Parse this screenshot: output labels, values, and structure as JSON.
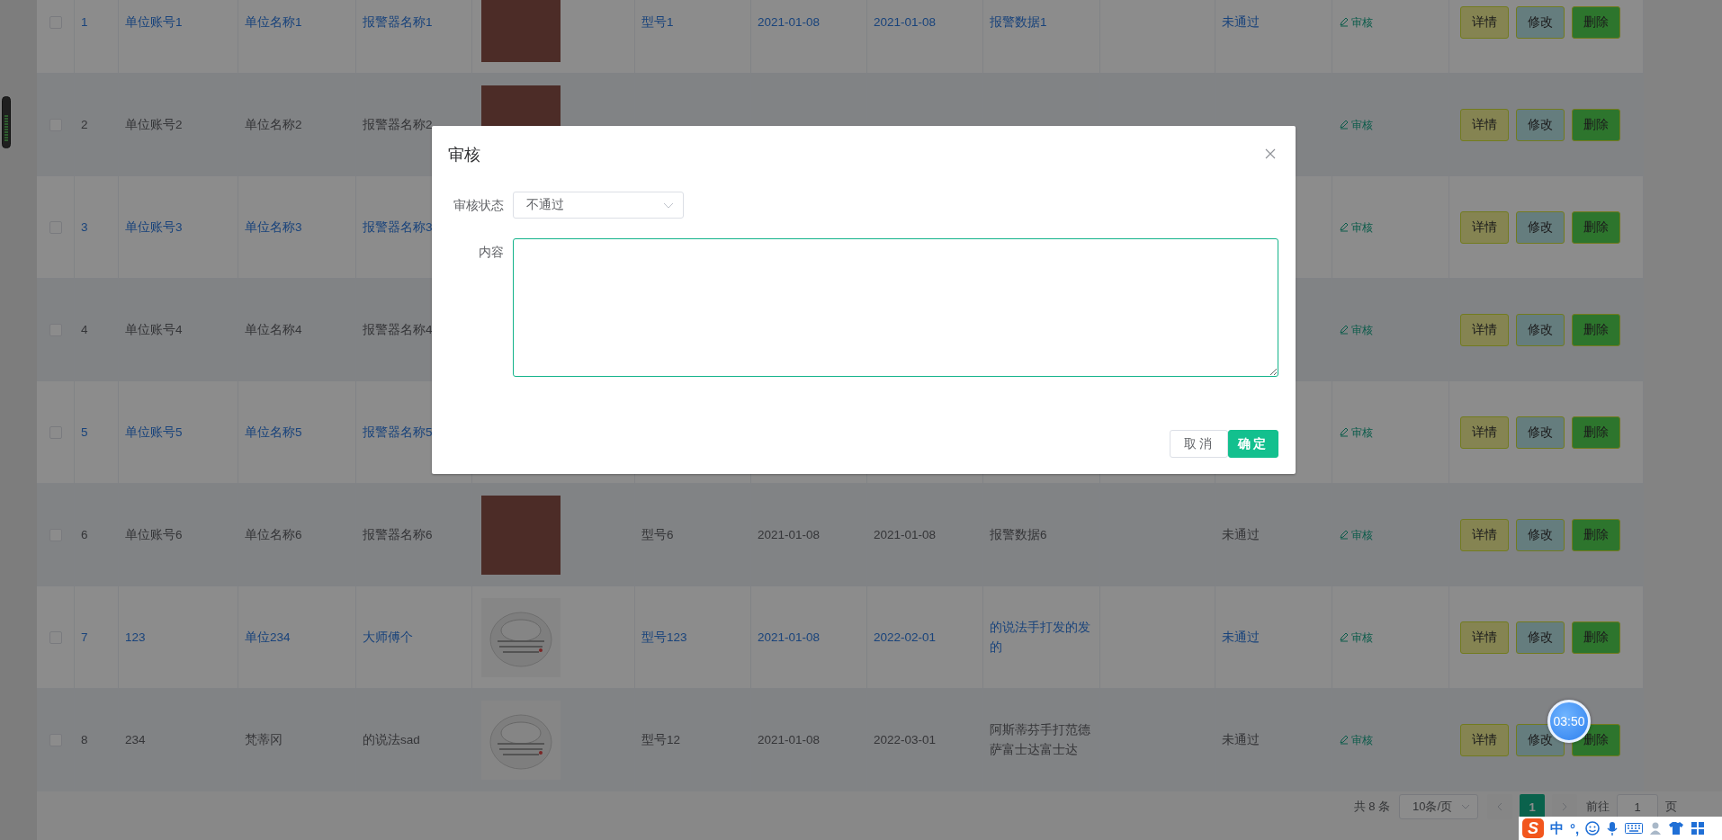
{
  "table": {
    "rows": [
      {
        "checked": false,
        "highlighted": true,
        "index": "1",
        "account": "单位账号1",
        "unit": "单位名称1",
        "alarm_name": "报警器名称1",
        "image": {
          "kind": "photo"
        },
        "model": "型号1",
        "date_1": "2021-01-08",
        "date_2": "2021-01-08",
        "alarm_data": "报警数据1",
        "status": "未通过",
        "audit": "审核",
        "actions": [
          {
            "label": "详情",
            "kind": "detail"
          },
          {
            "label": "修改",
            "kind": "edit"
          },
          {
            "label": "删除",
            "kind": "delete"
          }
        ]
      },
      {
        "checked": false,
        "highlighted": false,
        "index": "2",
        "account": "单位账号2",
        "unit": "单位名称2",
        "alarm_name": "报警器名称2",
        "image": {
          "kind": "photo"
        },
        "audit": "审核",
        "actions": [
          {
            "label": "详情",
            "kind": "detail"
          },
          {
            "label": "修改",
            "kind": "edit"
          },
          {
            "label": "删除",
            "kind": "delete"
          }
        ]
      },
      {
        "checked": false,
        "highlighted": true,
        "index": "3",
        "account": "单位账号3",
        "unit": "单位名称3",
        "alarm_name": "报警器名称3",
        "audit": "审核",
        "actions": [
          {
            "label": "详情",
            "kind": "detail"
          },
          {
            "label": "修改",
            "kind": "edit"
          },
          {
            "label": "删除",
            "kind": "delete"
          }
        ]
      },
      {
        "checked": false,
        "highlighted": false,
        "index": "4",
        "account": "单位账号4",
        "unit": "单位名称4",
        "alarm_name": "报警器名称4",
        "audit": "审核",
        "actions": [
          {
            "label": "详情",
            "kind": "detail"
          },
          {
            "label": "修改",
            "kind": "edit"
          },
          {
            "label": "删除",
            "kind": "delete"
          }
        ]
      },
      {
        "checked": false,
        "highlighted": true,
        "index": "5",
        "account": "单位账号5",
        "unit": "单位名称5",
        "alarm_name": "报警器名称5",
        "audit": "审核",
        "actions": [
          {
            "label": "详情",
            "kind": "detail"
          },
          {
            "label": "修改",
            "kind": "edit"
          },
          {
            "label": "删除",
            "kind": "delete"
          }
        ]
      },
      {
        "checked": false,
        "highlighted": false,
        "index": "6",
        "account": "单位账号6",
        "unit": "单位名称6",
        "alarm_name": "报警器名称6",
        "image": {
          "kind": "photo"
        },
        "model": "型号6",
        "date_1": "2021-01-08",
        "date_2": "2021-01-08",
        "alarm_data": "报警数据6",
        "status": "未通过",
        "audit": "审核",
        "actions": [
          {
            "label": "详情",
            "kind": "detail"
          },
          {
            "label": "修改",
            "kind": "edit"
          },
          {
            "label": "删除",
            "kind": "delete"
          }
        ]
      },
      {
        "checked": false,
        "highlighted": true,
        "index": "7",
        "account": "123",
        "unit": "单位234",
        "alarm_name": "大师傅个",
        "image": {
          "kind": "detector"
        },
        "model": "型号123",
        "date_1": "2021-01-08",
        "date_2": "2022-02-01",
        "alarm_data": "的说法手打发的发的",
        "status": "未通过",
        "audit": "审核",
        "actions": [
          {
            "label": "详情",
            "kind": "detail"
          },
          {
            "label": "修改",
            "kind": "edit"
          },
          {
            "label": "删除",
            "kind": "delete"
          }
        ]
      },
      {
        "checked": false,
        "highlighted": false,
        "index": "8",
        "account": "234",
        "unit": "梵蒂冈",
        "alarm_name": "的说法sad",
        "image": {
          "kind": "detector"
        },
        "model": "型号12",
        "date_1": "2021-01-08",
        "date_2": "2022-03-01",
        "alarm_data": "阿斯蒂芬手打范德萨富士达富士达",
        "status": "未通过",
        "audit": "审核",
        "actions": [
          {
            "label": "详情",
            "kind": "detail"
          },
          {
            "label": "修改",
            "kind": "edit"
          },
          {
            "label": "删除",
            "kind": "delete"
          }
        ]
      }
    ]
  },
  "pagination": {
    "total": "共 8 条",
    "page_size": "10条/页",
    "pages": [
      {
        "label": "1",
        "selected": true
      }
    ],
    "goto_label": "前往",
    "goto_value": "1",
    "page_suffix": "页"
  },
  "dialog": {
    "title": "审核",
    "status_field": {
      "label": "审核状态",
      "value": "不通过"
    },
    "content": {
      "label": "内容",
      "focused": true
    },
    "buttons": [
      {
        "label": "取消",
        "kind": "secondary"
      },
      {
        "label": "确定",
        "kind": "primary"
      }
    ]
  },
  "timer": {
    "time": "03:50"
  },
  "ime_toolbar": {
    "logo": "S",
    "mode": "中",
    "punctuation": "°,"
  }
}
